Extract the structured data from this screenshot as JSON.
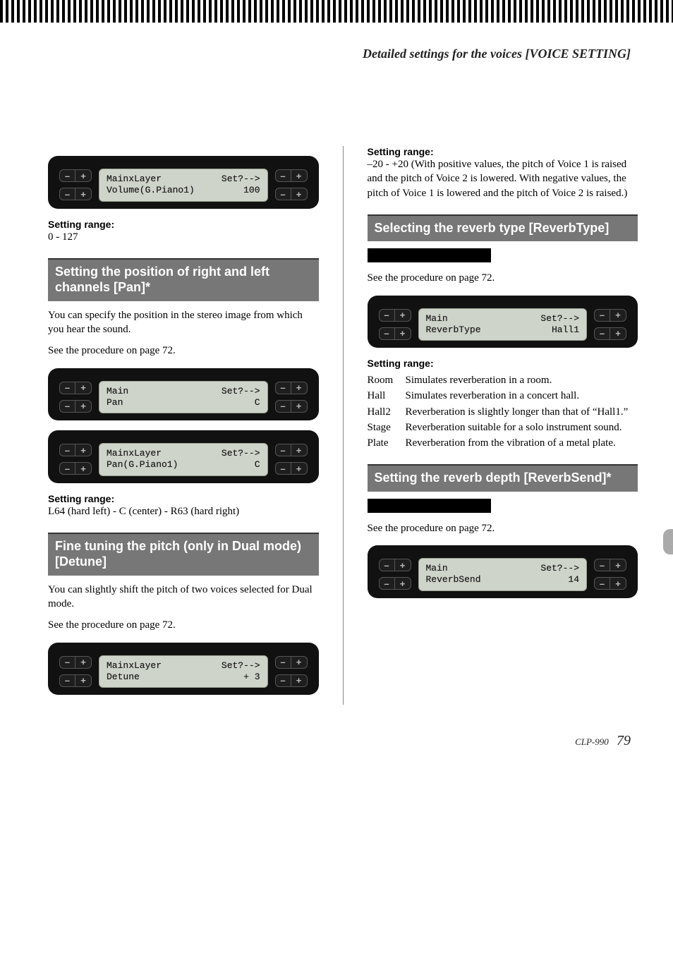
{
  "header": {
    "title": "Detailed settings for the voices [VOICE SETTING]"
  },
  "left": {
    "lcd1": {
      "l1a": "MainxLayer",
      "l1b": "Set?-->",
      "l2a": "Volume(G.Piano1)",
      "l2b": "100"
    },
    "range1_label": "Setting range:",
    "range1_val": "0 - 127",
    "heading_pan": "Setting the position of right and left channels [Pan]*",
    "pan_body1": "You can specify the position in the stereo image from which you hear the sound.",
    "pan_body2": "See the procedure on page 72.",
    "lcd2": {
      "l1a": "Main",
      "l1b": "Set?-->",
      "l2a": "Pan",
      "l2b": "C"
    },
    "lcd3": {
      "l1a": "MainxLayer",
      "l1b": "Set?-->",
      "l2a": "Pan(G.Piano1)",
      "l2b": "C"
    },
    "range2_label": "Setting range:",
    "range2_val": "L64 (hard left) - C (center) - R63 (hard right)",
    "heading_detune": "Fine tuning the pitch (only in Dual mode) [Detune]",
    "detune_body1": "You can slightly shift the pitch of two voices selected for Dual mode.",
    "detune_body2": "See the procedure on page 72.",
    "lcd4": {
      "l1a": "MainxLayer",
      "l1b": "Set?-->",
      "l2a": "Detune",
      "l2b": "+ 3"
    }
  },
  "right": {
    "range3_label": "Setting range:",
    "range3_val": "–20 - +20 (With positive values, the pitch of Voice 1 is raised and the pitch of Voice 2 is lowered. With negative values, the pitch of Voice 1 is lowered and the pitch of Voice 2 is raised.)",
    "heading_revtype": "Selecting the reverb type [ReverbType]",
    "revtype_body": "See the procedure on page 72.",
    "lcd5": {
      "l1a": "Main",
      "l1b": "Set?-->",
      "l2a": "ReverbType",
      "l2b": "Hall1"
    },
    "range4_label": "Setting range:",
    "options": [
      {
        "k": "Room",
        "v": "Simulates reverberation in a room."
      },
      {
        "k": "Hall",
        "v": "Simulates reverberation in a concert hall."
      },
      {
        "k": "Hall2",
        "v": "Reverberation is slightly longer than that of “Hall1.”"
      },
      {
        "k": "Stage",
        "v": "Reverberation suitable for a solo instrument sound."
      },
      {
        "k": "Plate",
        "v": "Reverberation from the vibration of a metal plate."
      }
    ],
    "heading_revsend": "Setting the reverb depth [ReverbSend]*",
    "revsend_body": "See the procedure on page 72.",
    "lcd6": {
      "l1a": "Main",
      "l1b": "Set?-->",
      "l2a": "ReverbSend",
      "l2b": "14"
    }
  },
  "footer": {
    "model": "CLP-990",
    "page": "79"
  },
  "glyphs": {
    "minus": "–",
    "plus": "+"
  }
}
